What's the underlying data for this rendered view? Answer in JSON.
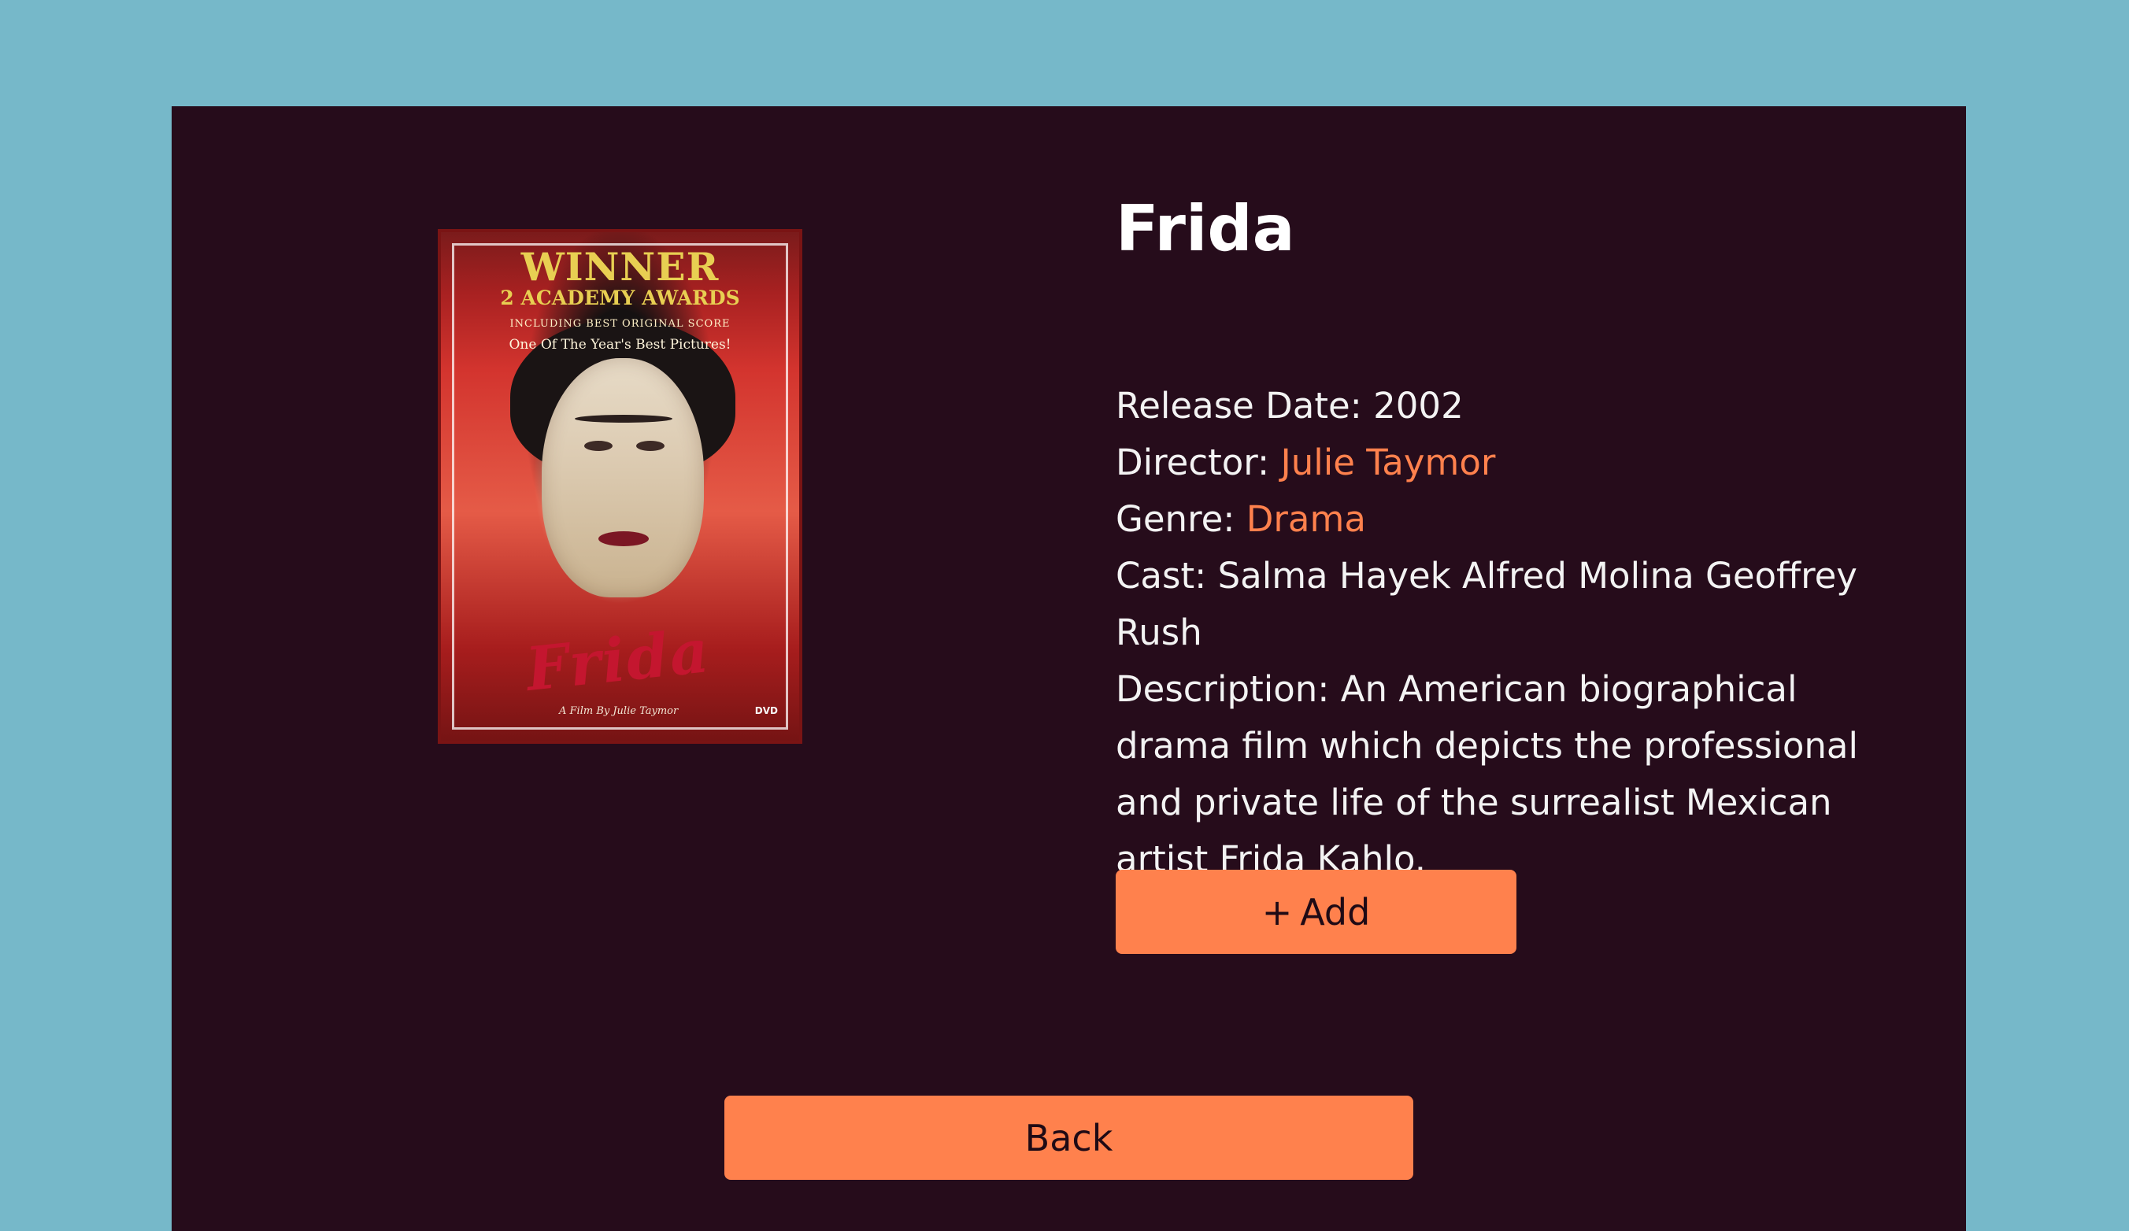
{
  "movie": {
    "title": "Frida",
    "poster": {
      "icon": "movie-poster-image",
      "top_line_1": "WINNER",
      "top_line_2": "2 ACADEMY AWARDS",
      "top_line_3": "INCLUDING BEST ORIGINAL SCORE",
      "top_line_4": "One Of The Year's Best Pictures!",
      "title": "Frida",
      "subtitle": "A Film By Julie Taymor",
      "badge": "DVD"
    },
    "details": {
      "release_date_label": "Release Date:",
      "release_date_value": "2002",
      "director_label": "Director:",
      "director_value": "Julie Taymor",
      "genre_label": "Genre:",
      "genre_value": "Drama",
      "cast_label": "Cast:",
      "cast_value": "Salma Hayek Alfred Molina Geoffrey Rush",
      "description_label": "Description:",
      "description_value": "An American biographical drama film which depicts the professional and private life of the surrealist Mexican artist Frida Kahlo."
    }
  },
  "actions": {
    "add_icon": "+",
    "add_label": "Add",
    "back_label": "Back"
  },
  "colors": {
    "page_background": "#76b8c9",
    "card_background": "#260c1b",
    "accent": "#ff814d",
    "text": "#ffffff"
  }
}
